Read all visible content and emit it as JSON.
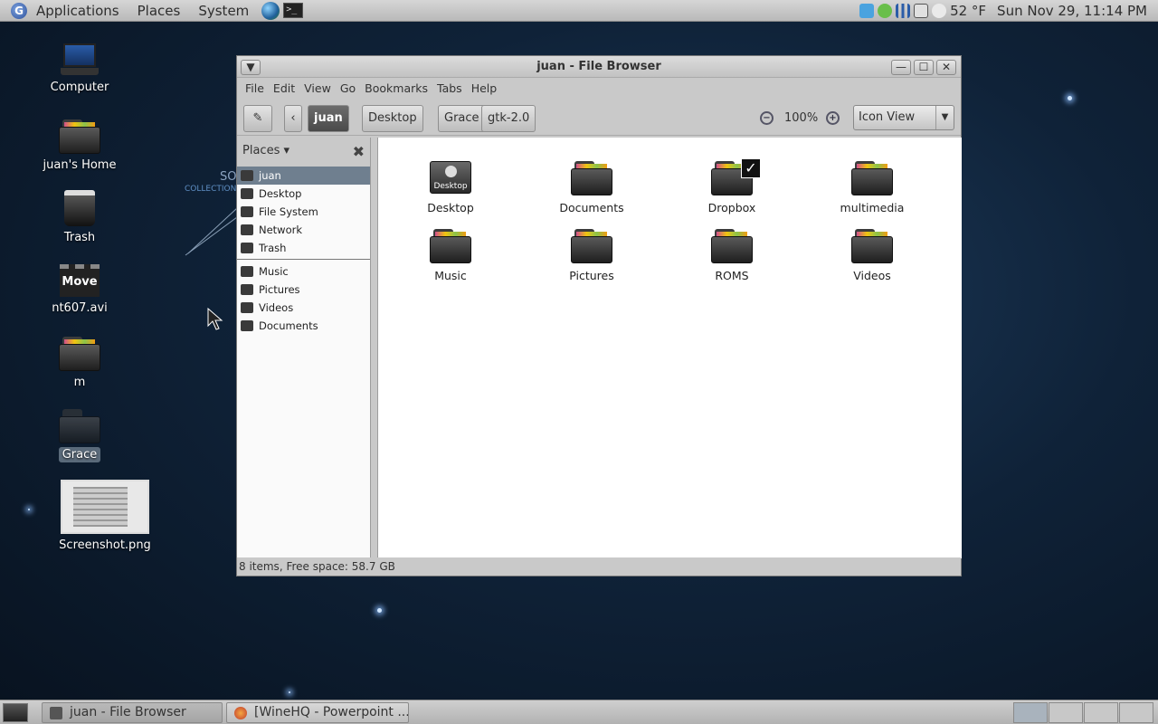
{
  "top_panel": {
    "menus": [
      "Applications",
      "Places",
      "System"
    ],
    "weather": "52 °F",
    "clock": "Sun Nov 29, 11:14 PM"
  },
  "desktop": {
    "icons": [
      {
        "label": "Computer"
      },
      {
        "label": "juan's Home"
      },
      {
        "label": "Trash"
      },
      {
        "label": "nt607.avi",
        "thumb_text": "Move"
      },
      {
        "label": "m"
      },
      {
        "label": "Grace"
      },
      {
        "label": "Screenshot.png"
      }
    ],
    "wallpaper_text": [
      "SO",
      "COLLECTION"
    ]
  },
  "window": {
    "title": "juan - File Browser",
    "menu": [
      "File",
      "Edit",
      "View",
      "Go",
      "Bookmarks",
      "Tabs",
      "Help"
    ],
    "path_buttons": [
      "juan",
      "Desktop",
      "Grace",
      "gtk-2.0"
    ],
    "zoom": "100%",
    "view_mode": "Icon View",
    "sidebar": {
      "header": "Places",
      "items": [
        "juan",
        "Desktop",
        "File System",
        "Network",
        "Trash"
      ],
      "bookmarks": [
        "Music",
        "Pictures",
        "Videos",
        "Documents"
      ]
    },
    "files": [
      "Desktop",
      "Documents",
      "Dropbox",
      "multimedia",
      "Music",
      "Pictures",
      "ROMS",
      "Videos"
    ],
    "desktop_icon_text": "Desktop",
    "status": "8 items, Free space: 58.7 GB"
  },
  "taskbar": {
    "tasks": [
      "juan - File Browser",
      "[WineHQ - Powerpoint ..."
    ]
  }
}
